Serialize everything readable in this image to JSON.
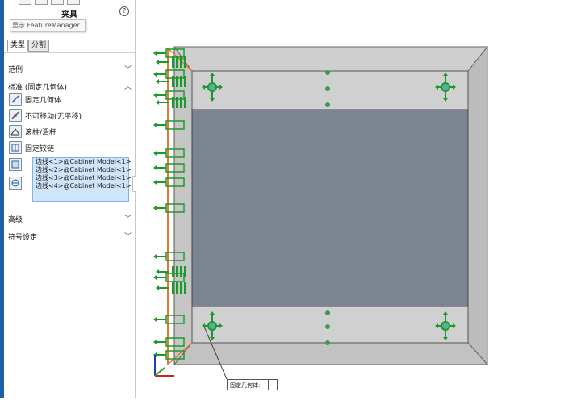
{
  "panel": {
    "title": "夹具",
    "help_glyph": "?",
    "tooltip": "显示 FeatureManager",
    "tabs": [
      {
        "label": "类型",
        "active": true
      },
      {
        "label": "分割",
        "active": false
      }
    ],
    "sections": {
      "examples": "范例",
      "standard": "标准 (固定几何体)",
      "advanced": "高级",
      "symbol_settings": "符号设定"
    },
    "fixture_options": [
      {
        "label": "固定几何体",
        "icon": "fixed-geometry-icon"
      },
      {
        "label": "不可移动(无平移)",
        "icon": "immovable-icon"
      },
      {
        "label": "滚柱/滑杆",
        "icon": "roller-slider-icon"
      },
      {
        "label": "固定铰链",
        "icon": "fixed-hinge-icon"
      }
    ],
    "selected_entities": [
      "边线<1>@Cabinet Model<1>",
      "边线<2>@Cabinet Model<1>",
      "边线<3>@Cabinet Model<1>",
      "边线<4>@Cabinet Model<1>"
    ]
  },
  "viewport": {
    "callout_label": "固定几何体:",
    "colors": {
      "frame": "#c8c8c8",
      "panel": "#7a8290",
      "fixture": "#1a9a2a",
      "edge": "#e07a30"
    }
  }
}
